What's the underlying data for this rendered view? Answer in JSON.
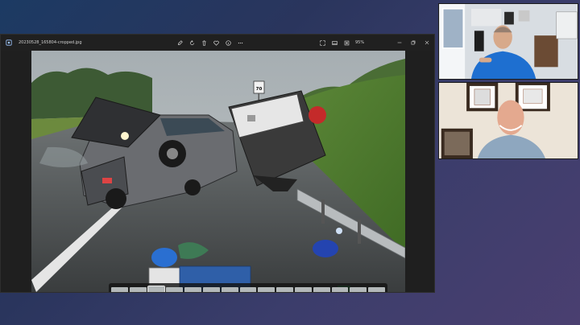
{
  "window": {
    "file_name": "20230528_165804-cropped.jpg",
    "zoom": "95%"
  },
  "icons": {
    "app": "photos-app-icon",
    "toolbar": [
      "edit-icon",
      "rotate-icon",
      "delete-icon",
      "favorite-icon",
      "info-icon",
      "more-icon"
    ],
    "right": [
      "fullscreen-icon",
      "filmstrip-toggle-icon",
      "fit-icon"
    ],
    "controls": [
      "minimize-icon",
      "restore-icon",
      "close-icon"
    ]
  },
  "photo": {
    "speed_sign": "70"
  },
  "filmstrip": {
    "count": 15,
    "selected_index": 2
  },
  "participants": [
    {
      "id": "participant-1"
    },
    {
      "id": "participant-2"
    }
  ]
}
